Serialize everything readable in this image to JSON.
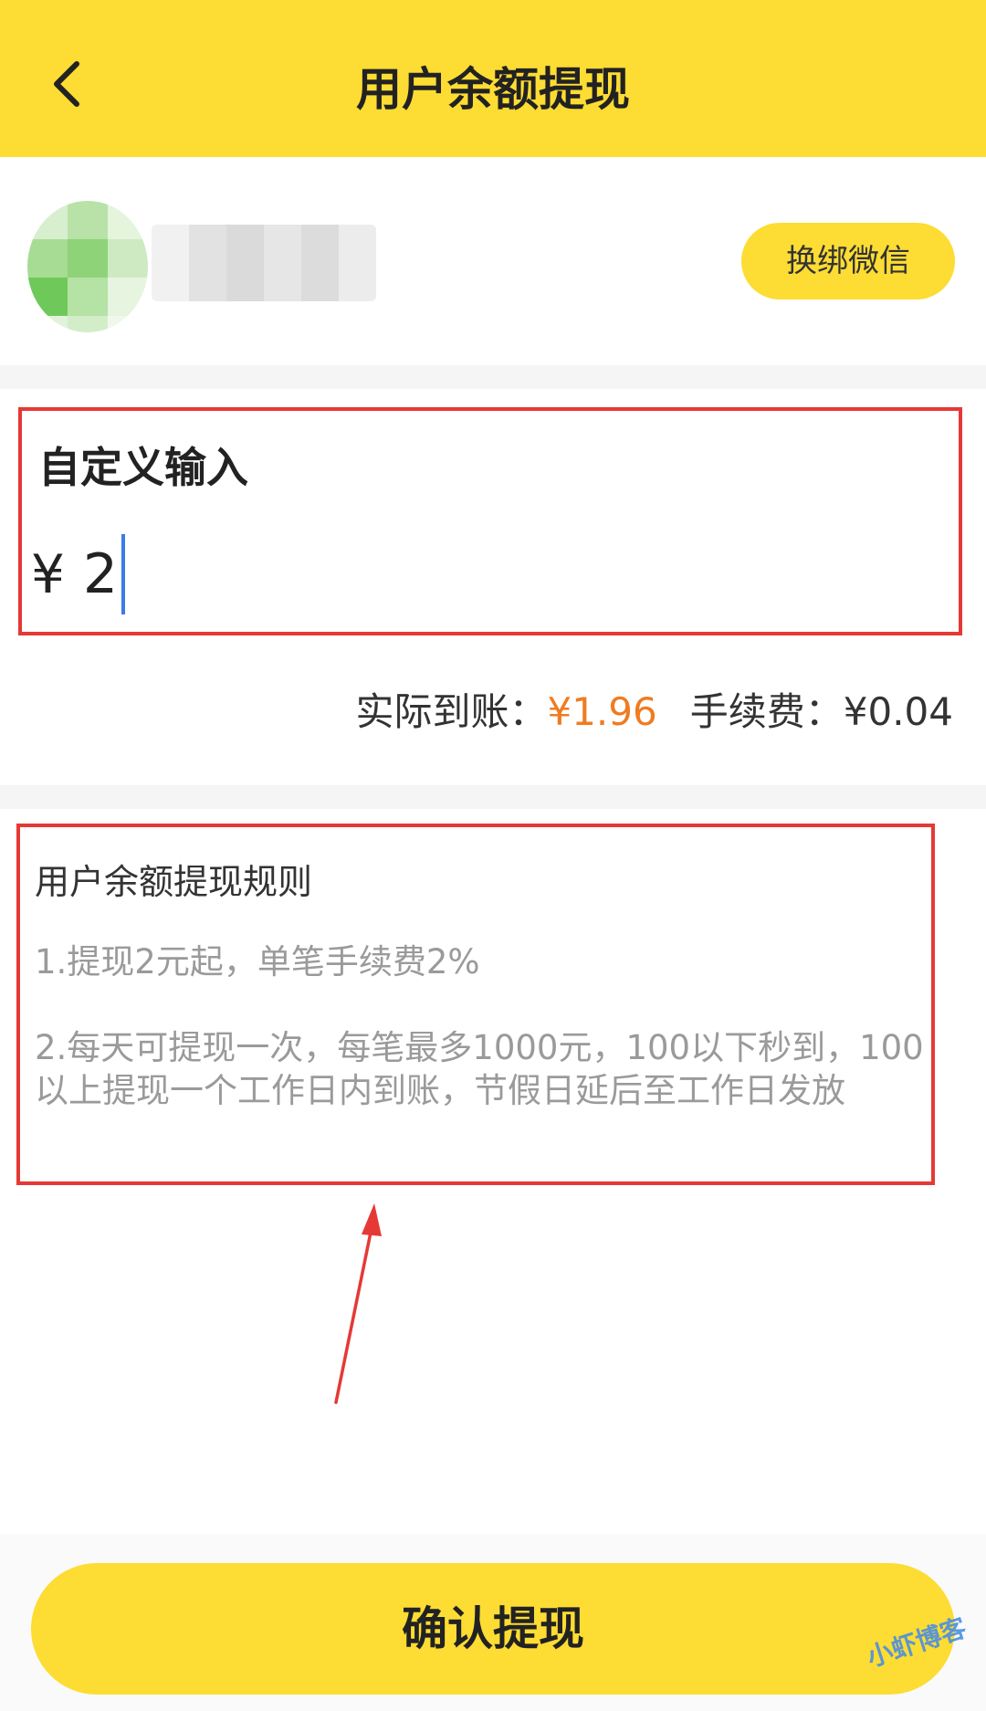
{
  "header": {
    "title": "用户余额提现",
    "back_icon": "chevron-left-icon"
  },
  "user": {
    "rebind_label": "换绑微信"
  },
  "amount": {
    "label": "自定义输入",
    "currency_symbol": "¥",
    "value": "2"
  },
  "fee": {
    "actual_label": "实际到账：",
    "actual_value": "¥1.96",
    "fee_label": "手续费：",
    "fee_value": "¥0.04"
  },
  "rules": {
    "title": "用户余额提现规则",
    "items": [
      "1.提现2元起，单笔手续费2%",
      "2.每天可提现一次，每笔最多1000元，100以下秒到，100以上提现一个工作日内到账，节假日延后至工作日发放"
    ]
  },
  "footer": {
    "confirm_label": "确认提现"
  },
  "watermark": {
    "text": "小虾博客"
  },
  "colors": {
    "brand_yellow": "#fddc33",
    "highlight_orange": "#f07b20",
    "annotation_red": "#e53935",
    "cursor_blue": "#3d7be6"
  }
}
